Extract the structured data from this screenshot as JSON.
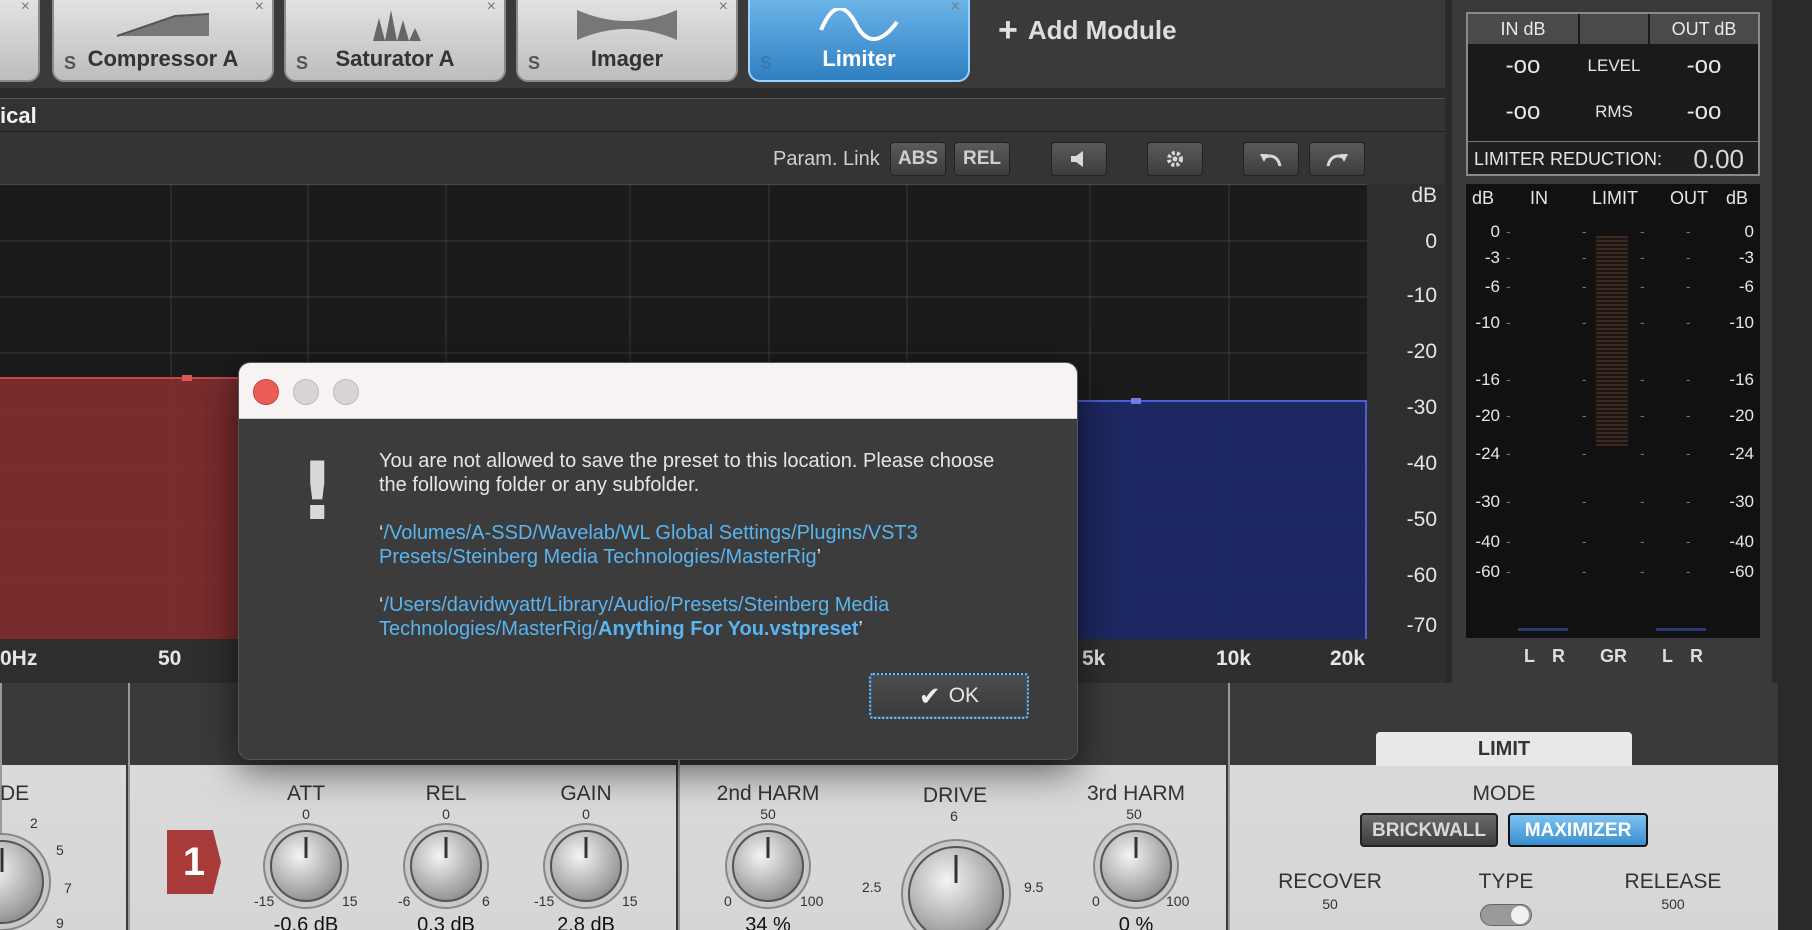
{
  "modules": {
    "tabs": [
      {
        "name": "Compressor A",
        "solo": "S",
        "close": "×",
        "active": false
      },
      {
        "name": "Saturator A",
        "solo": "S",
        "close": "×",
        "active": false
      },
      {
        "name": "Imager",
        "solo": "S",
        "close": "×",
        "active": false
      },
      {
        "name": "Limiter",
        "solo": "S",
        "close": "×",
        "active": true
      }
    ],
    "add_label": "Add Module",
    "add_icon": "+"
  },
  "section": {
    "title": "ical"
  },
  "toolbar": {
    "param_link": "Param. Link",
    "abs": "ABS",
    "rel": "REL",
    "speaker_icon": "speaker-icon",
    "gear_icon": "gear-icon",
    "undo_icon": "undo-icon",
    "redo_icon": "redo-icon"
  },
  "graph": {
    "db_unit": "dB",
    "db_ticks": [
      "0",
      "-10",
      "-20",
      "-30",
      "-40",
      "-50",
      "-60",
      "-70"
    ],
    "freq_ticks": [
      "0Hz",
      "50",
      "5k",
      "10k",
      "20k"
    ],
    "colors": {
      "low_band": "#8a2f2f",
      "high_band": "#1e2a6a",
      "background": "#1b1b1b"
    }
  },
  "meter": {
    "in_db": "IN dB",
    "out_db": "OUT dB",
    "level_label": "LEVEL",
    "rms_label": "RMS",
    "in_level": "-oo",
    "out_level": "-oo",
    "in_rms": "-oo",
    "out_rms": "-oo",
    "limiter_reduction_label": "LIMITER REDUCTION:",
    "limiter_reduction_value": "0.00",
    "headers": {
      "db_left": "dB",
      "in": "IN",
      "limit": "LIMIT",
      "out": "OUT",
      "db_right": "dB"
    },
    "scale": [
      "0",
      "-3",
      "-6",
      "-10",
      "-16",
      "-20",
      "-24",
      "-30",
      "-40",
      "-60"
    ],
    "footer": {
      "l1": "L",
      "r1": "R",
      "gr": "GR",
      "l2": "L",
      "r2": "R"
    }
  },
  "controls": {
    "partial_label": "DE",
    "partial_scale": [
      "2",
      "5",
      "7",
      "9"
    ],
    "band_number": "1",
    "att": {
      "label": "ATT",
      "top": "0",
      "min": "-15",
      "max": "15",
      "value": "-0.6 dB"
    },
    "rel": {
      "label": "REL",
      "top": "0",
      "min": "-6",
      "max": "6",
      "value": "0.3 dB"
    },
    "gain": {
      "label": "GAIN",
      "top": "0",
      "min": "-15",
      "max": "15",
      "value": "2.8 dB"
    },
    "harm2": {
      "label": "2nd HARM",
      "top": "50",
      "min": "0",
      "max": "100",
      "value": "34 %"
    },
    "drive": {
      "label": "DRIVE",
      "top": "6",
      "min": "2.5",
      "max": "9.5"
    },
    "harm3": {
      "label": "3rd HARM",
      "top": "50",
      "min": "0",
      "max": "100",
      "value": "0 %"
    },
    "limit_tab": "LIMIT",
    "mode_label": "MODE",
    "brickwall": "BRICKWALL",
    "maximizer": "MAXIMIZER",
    "recover": {
      "label": "RECOVER",
      "top": "50"
    },
    "type": {
      "label": "TYPE"
    },
    "release": {
      "label": "RELEASE",
      "top": "500"
    }
  },
  "dialog": {
    "message_line": "You are not allowed to save the preset to this location. Please choose the following folder or any subfolder.",
    "path1": "/Volumes/A-SSD/Wavelab/WL Global Settings/Plugins/VST3 Presets/Steinberg Media Technologies/MasterRig",
    "path2_prefix": "/Users/davidwyatt/Library/Audio/Presets/Steinberg Media Technologies/MasterRig/",
    "path2_file": "Anything For You.vstpreset",
    "ok": "OK",
    "icon": "exclamation-icon"
  }
}
